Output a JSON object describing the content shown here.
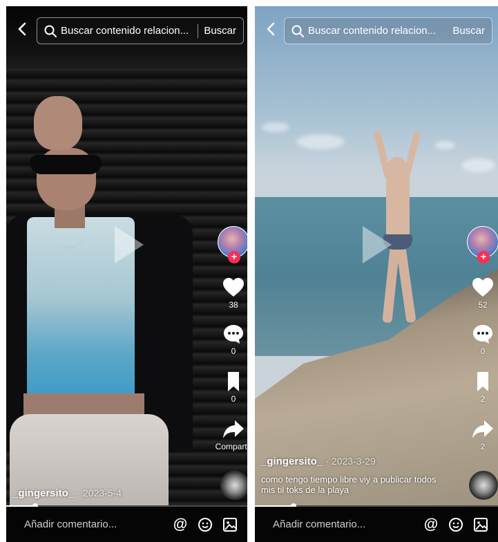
{
  "panels": [
    {
      "search": {
        "query": "Buscar contenido relacion...",
        "button": "Buscar"
      },
      "author": "_gingersito_",
      "date": "· 2023-5-4",
      "caption": "",
      "likes": "38",
      "comments": "0",
      "saves": "0",
      "share_label": "Compartir",
      "progress": 0.12,
      "comment_placeholder": "Añadir comentario..."
    },
    {
      "search": {
        "query": "Buscar contenido relacion...",
        "button": "Buscar"
      },
      "author": "_gingersito_",
      "date": "· 2023-3-29",
      "caption": "como tengo tiempo libre viy a publicar todos mis til toks de la playa",
      "likes": "52",
      "comments": "0",
      "saves": "2",
      "share_label": "2",
      "progress": 0.16,
      "comment_placeholder": "Añadir comentario..."
    }
  ],
  "colors": {
    "accent": "#fe2c55",
    "bar_bg": "#050505"
  },
  "icons": [
    "back-icon",
    "search-icon",
    "heart-icon",
    "comment-icon",
    "bookmark-icon",
    "share-icon",
    "at-icon",
    "emoji-icon",
    "image-icon"
  ]
}
